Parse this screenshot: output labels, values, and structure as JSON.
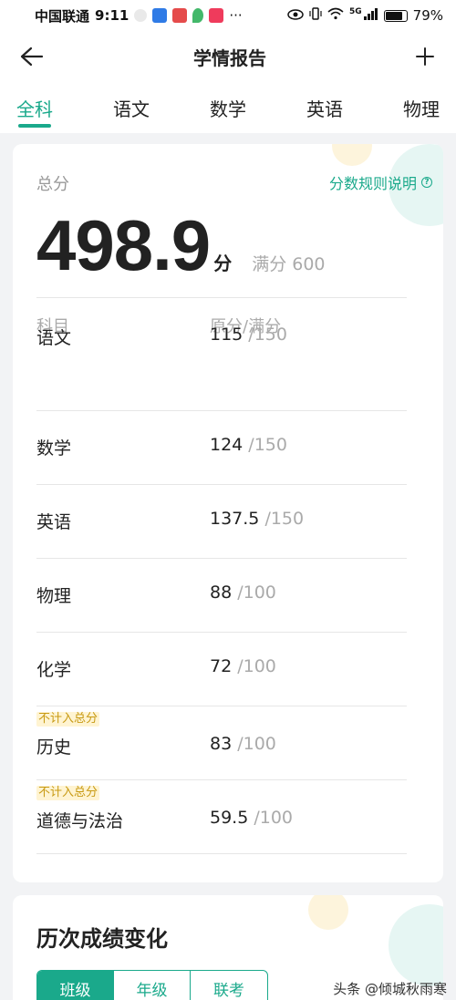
{
  "status_bar": {
    "carrier": "中国联通",
    "time": "9:11",
    "dots": "···",
    "battery": "79%",
    "network": "5G"
  },
  "header": {
    "title": "学情报告"
  },
  "tabs": [
    {
      "label": "全科",
      "active": true
    },
    {
      "label": "语文",
      "active": false
    },
    {
      "label": "数学",
      "active": false
    },
    {
      "label": "英语",
      "active": false
    },
    {
      "label": "物理",
      "active": false
    }
  ],
  "score_card": {
    "total_label": "总分",
    "rule_link": "分数规则说明",
    "total_value": "498.9",
    "total_unit": "分",
    "full_score": "满分 600",
    "col_subject": "科目",
    "col_score": "原分/满分",
    "rows": [
      {
        "subject": "语文",
        "score": "115",
        "max": " /150",
        "badge": ""
      },
      {
        "subject": "数学",
        "score": "124",
        "max": " /150",
        "badge": ""
      },
      {
        "subject": "英语",
        "score": "137.5",
        "max": " /150",
        "badge": ""
      },
      {
        "subject": "物理",
        "score": "88",
        "max": " /100",
        "badge": ""
      },
      {
        "subject": "化学",
        "score": "72",
        "max": " /100",
        "badge": ""
      },
      {
        "subject": "历史",
        "score": "83",
        "max": " /100",
        "badge": "不计入总分"
      },
      {
        "subject": "道德与法治",
        "score": "59.5",
        "max": " /100",
        "badge": "不计入总分"
      }
    ]
  },
  "trend_card": {
    "title": "历次成绩变化",
    "segments": [
      {
        "label": "班级",
        "active": true
      },
      {
        "label": "年级",
        "active": false
      },
      {
        "label": "联考",
        "active": false
      }
    ]
  },
  "watermark": "头条 @倾城秋雨寒",
  "colors": {
    "accent": "#1aa98b",
    "badge_text": "#c89a14",
    "badge_bg": "#fff4d2"
  }
}
